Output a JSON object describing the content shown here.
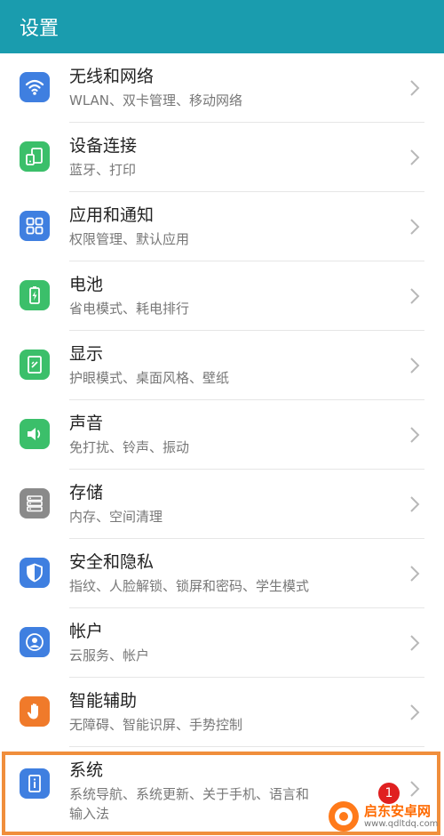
{
  "header": {
    "title": "设置"
  },
  "items": [
    {
      "label": "无线和网络",
      "sub": "WLAN、双卡管理、移动网络",
      "icon": "wifi-icon",
      "color": "#3f7fe0"
    },
    {
      "label": "设备连接",
      "sub": "蓝牙、打印",
      "icon": "device-connect-icon",
      "color": "#3bbf6a"
    },
    {
      "label": "应用和通知",
      "sub": "权限管理、默认应用",
      "icon": "apps-icon",
      "color": "#3f7fe0"
    },
    {
      "label": "电池",
      "sub": "省电模式、耗电排行",
      "icon": "battery-icon",
      "color": "#3bbf6a"
    },
    {
      "label": "显示",
      "sub": "护眼模式、桌面风格、壁纸",
      "icon": "display-icon",
      "color": "#3bbf6a"
    },
    {
      "label": "声音",
      "sub": "免打扰、铃声、振动",
      "icon": "sound-icon",
      "color": "#3bbf6a"
    },
    {
      "label": "存储",
      "sub": "内存、空间清理",
      "icon": "storage-icon",
      "color": "#8a8a8a"
    },
    {
      "label": "安全和隐私",
      "sub": "指纹、人脸解锁、锁屏和密码、学生模式",
      "icon": "shield-icon",
      "color": "#3f7fe0"
    },
    {
      "label": "帐户",
      "sub": "云服务、帐户",
      "icon": "account-icon",
      "color": "#3f7fe0"
    },
    {
      "label": "智能辅助",
      "sub": "无障碍、智能识屏、手势控制",
      "icon": "hand-icon",
      "color": "#f07a2a"
    },
    {
      "label": "系统",
      "sub": "系统导航、系统更新、关于手机、语言和",
      "sub2": "输入法",
      "icon": "system-icon",
      "color": "#3f7fe0"
    }
  ],
  "badge": {
    "count": "1"
  },
  "watermark": {
    "brand": "启东安卓网",
    "url": "www.qdltdq.com"
  },
  "colors": {
    "titlebar": "#1a9cae",
    "highlight": "#f08e3c"
  }
}
